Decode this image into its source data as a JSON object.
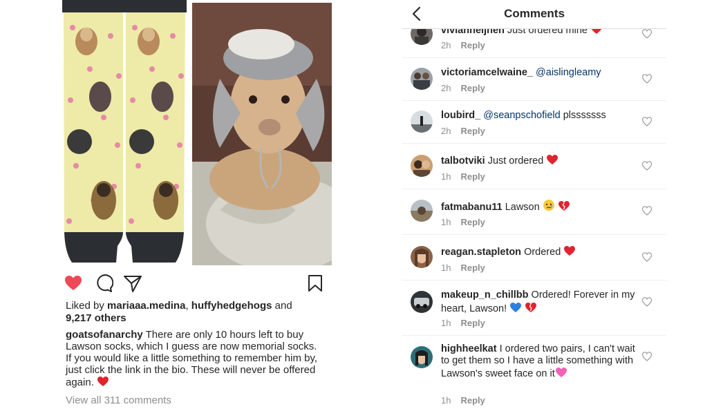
{
  "post": {
    "liked_prefix": "Liked by",
    "liked_user1": "mariaaa.medina",
    "liked_sep": ",",
    "liked_user2": "huffyhedgehogs",
    "liked_and": "and",
    "liked_others": "9,217 others",
    "caption_user": "goatsofanarchy",
    "caption_text": "There are only 10 hours left to buy Lawson socks, which I guess are now memorial socks. If you would like a little something to remember him by, just click the link in the bio. These will never be offered again.",
    "caption_emoji": "red-heart",
    "view_all": "View all 311 comments",
    "icons": [
      "heart-filled-icon",
      "comment-icon",
      "share-icon",
      "bookmark-icon"
    ],
    "colors": {
      "like_red": "#ed4956",
      "sock_bg": "#eeeaa8",
      "sock_toe": "#2b2f33"
    }
  },
  "comments_panel": {
    "title": "Comments",
    "reply_label": "Reply",
    "items": [
      {
        "user": "vivianneijnen",
        "text": "Just ordered mine",
        "mention": "",
        "time": "2h",
        "emoji": "red-heart"
      },
      {
        "user": "victoriamcelwaine_",
        "text": "",
        "mention": "@aislingleamy",
        "time": "2h",
        "emoji": ""
      },
      {
        "user": "loubird_",
        "text": "plsssssss",
        "mention": "@seanpschofield",
        "time": "2h",
        "emoji": ""
      },
      {
        "user": "talbotviki",
        "text": "Just ordered",
        "mention": "",
        "time": "1h",
        "emoji": "red-heart"
      },
      {
        "user": "fatmabanu11",
        "text": "Lawson",
        "mention": "",
        "time": "1h",
        "emoji": "crying-face broken-heart"
      },
      {
        "user": "reagan.stapleton",
        "text": "Ordered",
        "mention": "",
        "time": "1h",
        "emoji": "red-heart"
      },
      {
        "user": "makeup_n_chillbb",
        "text": "Ordered! Forever in my heart, Lawson!",
        "mention": "",
        "time": "1h",
        "emoji": "blue-heart broken-heart"
      },
      {
        "user": "highheelkat",
        "text": "I ordered two pairs, I can't wait to get them so I have a little something with Lawson's sweet face on it",
        "mention": "",
        "time": "1h",
        "emoji": "pink-heart"
      }
    ]
  }
}
